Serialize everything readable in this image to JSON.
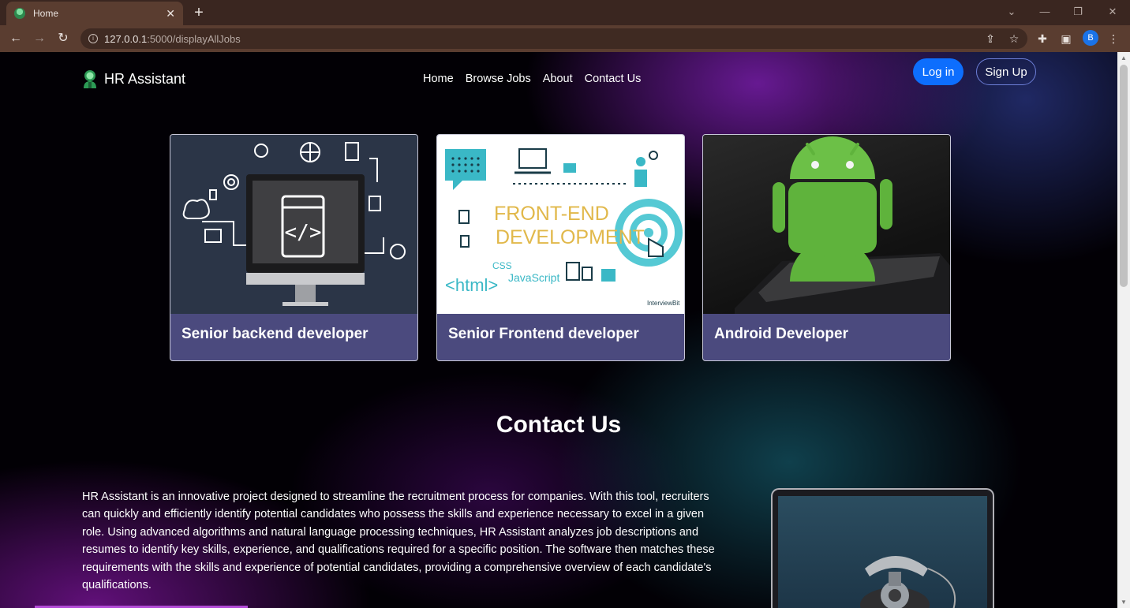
{
  "browser": {
    "tab_title": "Home",
    "url_host": "127.0.0.1",
    "url_path": ":5000/displayAllJobs",
    "profile_initial": "B"
  },
  "navbar": {
    "brand": "HR Assistant",
    "links": [
      "Home",
      "Browse Jobs",
      "About",
      "Contact Us"
    ],
    "login": "Log in",
    "signup": "Sign Up"
  },
  "jobs": [
    {
      "title": "Senior backend developer"
    },
    {
      "title": "Senior Frontend developer",
      "image_text_1": "FRONT-END",
      "image_text_2": "DEVELOPMENT",
      "image_text_3": "<html>",
      "image_text_4": "CSS",
      "image_text_5": "JavaScript",
      "image_text_6": "InterviewBit"
    },
    {
      "title": "Android Developer"
    }
  ],
  "contact": {
    "title": "Contact Us",
    "text": "HR Assistant is an innovative project designed to streamline the recruitment process for companies. With this tool, recruiters can quickly and efficiently identify potential candidates who possess the skills and experience necessary to excel in a given role. Using advanced algorithms and natural language processing techniques, HR Assistant analyzes job descriptions and resumes to identify key skills, experience, and qualifications required for a specific position. The software then matches these requirements with the skills and experience of potential candidates, providing a comprehensive overview of each candidate's qualifications."
  }
}
